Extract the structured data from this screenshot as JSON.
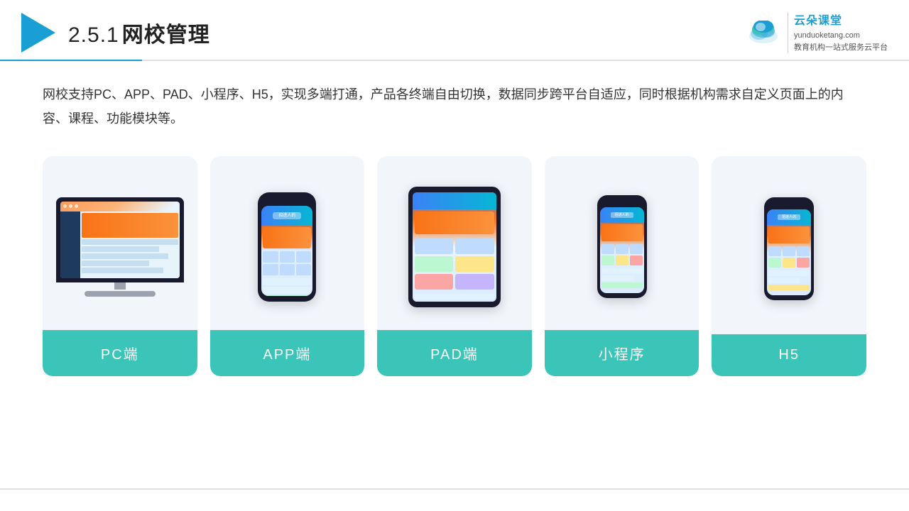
{
  "header": {
    "section_number": "2.5.1",
    "title": "网校管理",
    "divider_color": "#1a9fd4"
  },
  "brand": {
    "name": "云朵课堂",
    "domain": "yunduoketang.com",
    "tagline": "教育机构一站式服务云平台"
  },
  "description": {
    "text": "网校支持PC、APP、PAD、小程序、H5，实现多端打通，产品各终端自由切换，数据同步跨平台自适应，同时根据机构需求自定义页面上的内容、课程、功能模块等。"
  },
  "cards": [
    {
      "id": "pc",
      "label": "PC端",
      "device_type": "monitor"
    },
    {
      "id": "app",
      "label": "APP端",
      "device_type": "phone"
    },
    {
      "id": "pad",
      "label": "PAD端",
      "device_type": "tablet"
    },
    {
      "id": "mini",
      "label": "小程序",
      "device_type": "phone-small"
    },
    {
      "id": "h5",
      "label": "H5",
      "device_type": "phone-small2"
    }
  ],
  "colors": {
    "accent": "#3bc4b8",
    "header_accent": "#1a9fd4",
    "card_bg": "#f2f6fb",
    "label_bg": "#3bc4b8"
  }
}
